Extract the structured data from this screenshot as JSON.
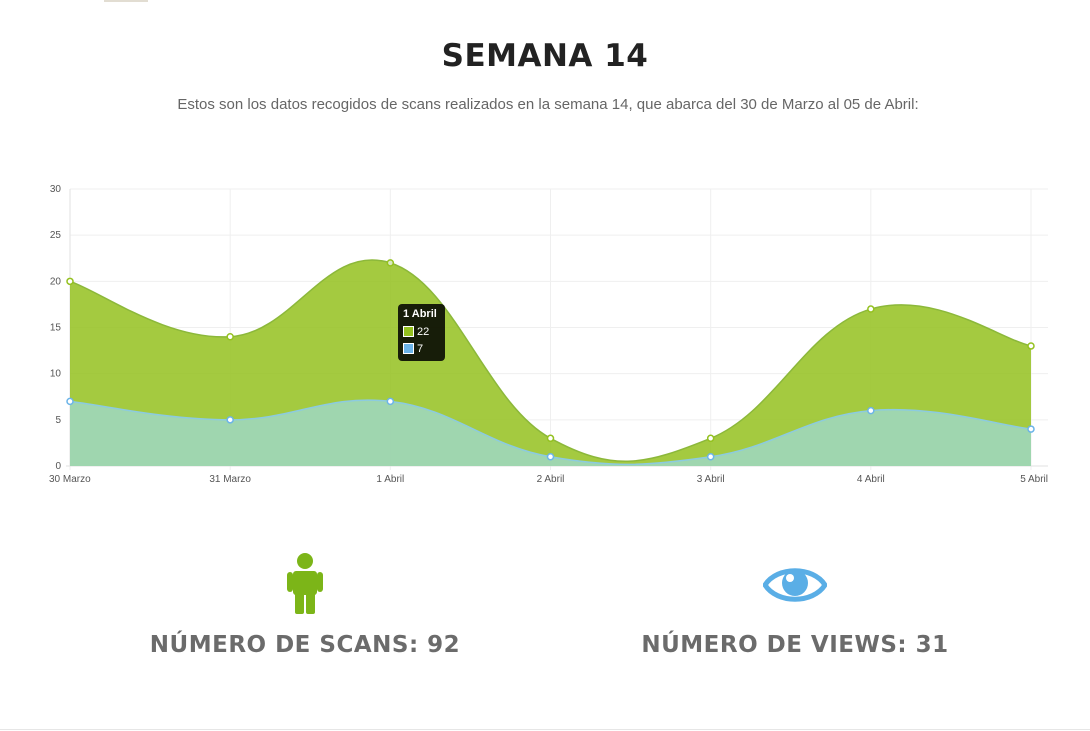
{
  "header": {
    "title": "SEMANA 14",
    "subtitle": "Estos son los datos recogidos de scans realizados en la semana 14, que abarca del 30 de Marzo al 05 de Abril:"
  },
  "chart_data": {
    "type": "area",
    "title": "",
    "xlabel": "",
    "ylabel": "",
    "categories": [
      "30 Marzo",
      "31 Marzo",
      "1 Abril",
      "2 Abril",
      "3 Abril",
      "4 Abril",
      "5 Abril"
    ],
    "series": [
      {
        "values": [
          20,
          14,
          22,
          3,
          3,
          17,
          13
        ],
        "color": "#94c11f"
      },
      {
        "values": [
          7,
          5,
          7,
          1,
          1,
          6,
          4
        ],
        "color": "#9fd6b5",
        "point_color": "#6cb4e8"
      }
    ],
    "ylim": [
      0,
      30
    ],
    "yticks": [
      0,
      5,
      10,
      15,
      20,
      25,
      30
    ],
    "grid": true,
    "smooth": true,
    "tooltip": {
      "title": "1 Abril",
      "rows": [
        {
          "value": "22",
          "color": "#94c11f"
        },
        {
          "value": "7",
          "color": "#6cb4e8"
        }
      ]
    }
  },
  "stats": {
    "scans": {
      "label": "NÚMERO DE SCANS: 92",
      "icon": "person-icon",
      "color": "#7cb518"
    },
    "views": {
      "label": "NÚMERO DE VIEWS: 31",
      "icon": "eye-icon",
      "color": "#5aaee6"
    }
  }
}
